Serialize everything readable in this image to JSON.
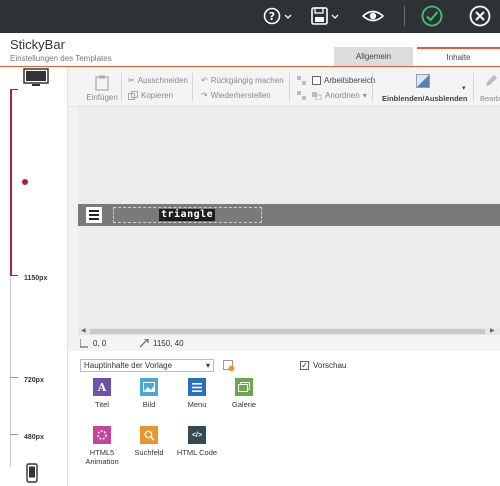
{
  "app": {
    "title": "StickyBar",
    "subtitle": "Einstellungen des Templates"
  },
  "tabs": [
    {
      "label": "Allgemein"
    },
    {
      "label": "Inhalte"
    }
  ],
  "ruler": {
    "labels": [
      "1150px",
      "720px",
      "480px"
    ]
  },
  "toolbar": {
    "einfuegen": "Einfügen",
    "ausschneiden": "Ausschneiden",
    "kopieren": "Kopieren",
    "rueckgaengig": "Rückgängig machen",
    "wiederherstellen": "Wiederherstellen",
    "arbeitsbereich": "Arbeitsbereich",
    "anordnen": "Anordnen",
    "einblenden": "Einblenden/Ausblenden",
    "bearbeiten": "Bearbe"
  },
  "canvas": {
    "logo_text": "triangle"
  },
  "coords": {
    "position": "0, 0",
    "size": "1150, 40"
  },
  "panel": {
    "select_value": "Hauptinhalte der Vorlage",
    "preview_label": "Vorschau",
    "widgets": [
      {
        "label": "Titel",
        "icon": "text-a-icon",
        "color": "#6b54a8"
      },
      {
        "label": "Bild",
        "icon": "image-icon",
        "color": "#4aa7d8"
      },
      {
        "label": "Menu",
        "icon": "menu-icon",
        "color": "#2b6fc1"
      },
      {
        "label": "Galerie",
        "icon": "gallery-icon",
        "color": "#6aa84f"
      },
      {
        "label": "HTML5 Animation",
        "icon": "animation-icon",
        "color": "#c2479b"
      },
      {
        "label": "Suchfeld",
        "icon": "search-icon",
        "color": "#e8962f"
      },
      {
        "label": "HTML Code",
        "icon": "code-icon",
        "color": "#354955"
      }
    ]
  },
  "colors": {
    "accent": "#e15b3a",
    "ruler_active": "#b0213f",
    "topbar": "#2e3235",
    "confirm": "#3fc37a"
  }
}
